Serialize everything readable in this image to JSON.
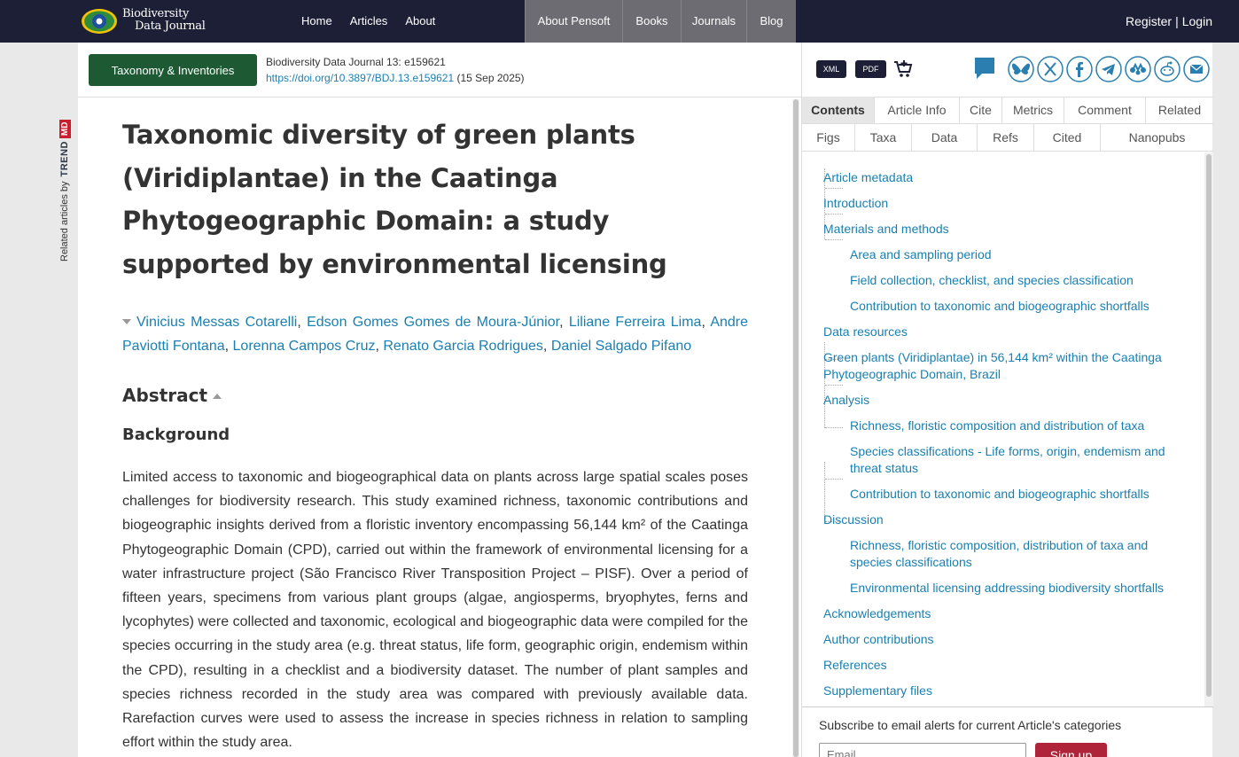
{
  "header": {
    "logo_line1": "Biodiversity",
    "logo_line2": "Data Journal",
    "nav": [
      "Home",
      "Articles",
      "About"
    ],
    "pensoft_nav": [
      "About Pensoft",
      "Books",
      "Journals",
      "Blog"
    ],
    "register": "Register",
    "separator": "|",
    "login": "Login"
  },
  "trendmd": {
    "label": "Related articles by",
    "brand": "TREND",
    "brand_badge": "MD"
  },
  "article_header": {
    "category": "Taxonomy & Inventories",
    "journal_ref": "Biodiversity Data Journal 13: e159621",
    "doi": "https://doi.org/10.3897/BDJ.13.e159621",
    "date": "(15 Sep 2025)"
  },
  "article": {
    "title": "Taxonomic diversity of green plants (Viridiplantae) in the Caatinga Phytogeographic Domain: a study supported by environmental licensing",
    "authors": [
      "Vinicius Messas Cotarelli",
      "Edson Gomes Gomes de Moura-Júnior",
      "Liliane Ferreira Lima",
      "Andre Paviotti Fontana",
      "Lorenna Campos Cruz",
      "Renato Garcia Rodrigues",
      "Daniel Salgado Pifano"
    ],
    "abstract_heading": "Abstract",
    "background_heading": "Background",
    "abstract_text": "Limited access to taxonomic and biogeographical data on plants across large spatial scales poses challenges for biodiversity research. This study examined richness, taxonomic contributions and biogeographic insights derived from a floristic inventory encompassing 56,144 km² of the Caatinga Phytogeographic Domain (CPD), carried out within the framework of environmental licensing for a water infrastructure project (São Francisco River Transposition Project – PISF). Over a period of fifteen years, specimens from various plant groups (algae, angiosperms, bryophytes, ferns and lycophytes) were collected and taxonomic, ecological and biogeographic data were compiled for the species occurring in the study area (e.g. threat status, life form, geographic origin, endemism within the CPD), resulting in a checklist and a biodiversity dataset. The number of plant samples and species richness recorded in the study area was compared with previously available data. Rarefaction curves were used to assess the increase in species richness in relation to sampling effort within the study area."
  },
  "tools": {
    "xml": "XML",
    "pdf": "PDF",
    "share_icons": [
      "bluesky-icon",
      "x-icon",
      "facebook-icon",
      "telegram-icon",
      "mendeley-icon",
      "reddit-icon",
      "email-icon"
    ]
  },
  "tabs_row1": [
    "Contents",
    "Article Info",
    "Cite",
    "Metrics",
    "Comment",
    "Related"
  ],
  "tabs_row2": [
    "Figs",
    "Taxa",
    "Data",
    "Refs",
    "Cited",
    "Nanopubs"
  ],
  "toc": [
    {
      "label": "Article metadata",
      "level": 0
    },
    {
      "label": "Introduction",
      "level": 0
    },
    {
      "label": "Materials and methods",
      "level": 0
    },
    {
      "label": "Area and sampling period",
      "level": 1
    },
    {
      "label": "Field collection, checklist, and species classification",
      "level": 1
    },
    {
      "label": "Contribution to taxonomic and biogeographic shortfalls",
      "level": 1
    },
    {
      "label": "Data resources",
      "level": 0
    },
    {
      "label": "Green plants (Viridiplantae) in 56,144 km² within the Caatinga Phytogeographic Domain, Brazil",
      "level": 0
    },
    {
      "label": "Analysis",
      "level": 0
    },
    {
      "label": "Richness, floristic composition and distribution of taxa",
      "level": 1
    },
    {
      "label": "Species classifications - Life forms, origin, endemism and threat status",
      "level": 1
    },
    {
      "label": "Contribution to taxonomic and biogeographic shortfalls",
      "level": 1
    },
    {
      "label": "Discussion",
      "level": 0
    },
    {
      "label": "Richness, floristic composition, distribution of taxa and species classifications",
      "level": 1
    },
    {
      "label": "Environmental licensing addressing biodiversity shortfalls",
      "level": 1
    },
    {
      "label": "Acknowledgements",
      "level": 0
    },
    {
      "label": "Author contributions",
      "level": 0
    },
    {
      "label": "References",
      "level": 0
    },
    {
      "label": "Supplementary files",
      "level": 0
    }
  ],
  "subscribe": {
    "text": "Subscribe to email alerts for current Article's categories",
    "placeholder": "Email",
    "button": "Sign up"
  },
  "colors": {
    "topbar": "#1c1f35",
    "link": "#1a7fb0",
    "category": "#1d5a34",
    "signup": "#b0243a"
  }
}
